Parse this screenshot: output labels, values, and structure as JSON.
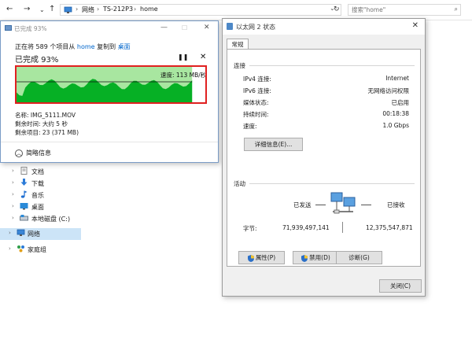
{
  "explorer": {
    "back_icon": "back-arrow-icon",
    "forward_icon": "forward-arrow-icon",
    "breadcrumbs": [
      "网络",
      "TS-212P3",
      "home"
    ],
    "search_placeholder": "搜索\"home\"",
    "nav": [
      {
        "label": "文档",
        "icon": "documents-icon",
        "color": "#8a8a8a"
      },
      {
        "label": "下载",
        "icon": "download-icon",
        "color": "#2b7bd8"
      },
      {
        "label": "音乐",
        "icon": "music-icon",
        "color": "#1f6fd1"
      },
      {
        "label": "桌面",
        "icon": "desktop-icon",
        "color": "#2a8ad8"
      },
      {
        "label": "本地磁盘 (C:)",
        "icon": "drive-icon",
        "color": "#6d7c8a"
      },
      {
        "label": "网络",
        "icon": "network-icon",
        "color": "#3b86d6",
        "selected": true
      },
      {
        "label": "家庭组",
        "icon": "homegroup-icon",
        "color": "#2f9e4a"
      }
    ]
  },
  "copy": {
    "title": "已完成 93%",
    "line_prefix": "正在将 589 个项目从 ",
    "source": "home",
    "line_mid": " 复制到 ",
    "destination": "桌面",
    "percent": "已完成 93%",
    "progress": 0.93,
    "speed": "速度: 113 MB/秒",
    "name": "名称: IMG_5111.MOV",
    "remaining_time": "剩余时间: 大约 5 秒",
    "remaining_items": "剩余项目: 23 (371 MB)",
    "less_details": "简略信息",
    "colors": {
      "fill": "#06b025",
      "fill_light": "#a8e6a0",
      "border": "#e02020"
    }
  },
  "eth": {
    "title": "以太网 2 状态",
    "tab": "常规",
    "connection_header": "连接",
    "rows": [
      {
        "k": "IPv4 连接:",
        "v": "Internet"
      },
      {
        "k": "IPv6 连接:",
        "v": "无网络访问权限"
      },
      {
        "k": "媒体状态:",
        "v": "已启用"
      },
      {
        "k": "持续时间:",
        "v": "00:18:38"
      },
      {
        "k": "速度:",
        "v": "1.0 Gbps"
      }
    ],
    "details_button": "详细信息(E)...",
    "activity_header": "活动",
    "sent_label": "已发送",
    "received_label": "已接收",
    "bytes_label": "字节:",
    "bytes_sent": "71,939,497,141",
    "bytes_received": "12,375,547,871",
    "properties_button": "属性(P)",
    "disable_button": "禁用(D)",
    "diagnose_button": "诊断(G)",
    "close_button": "关闭(C)"
  }
}
